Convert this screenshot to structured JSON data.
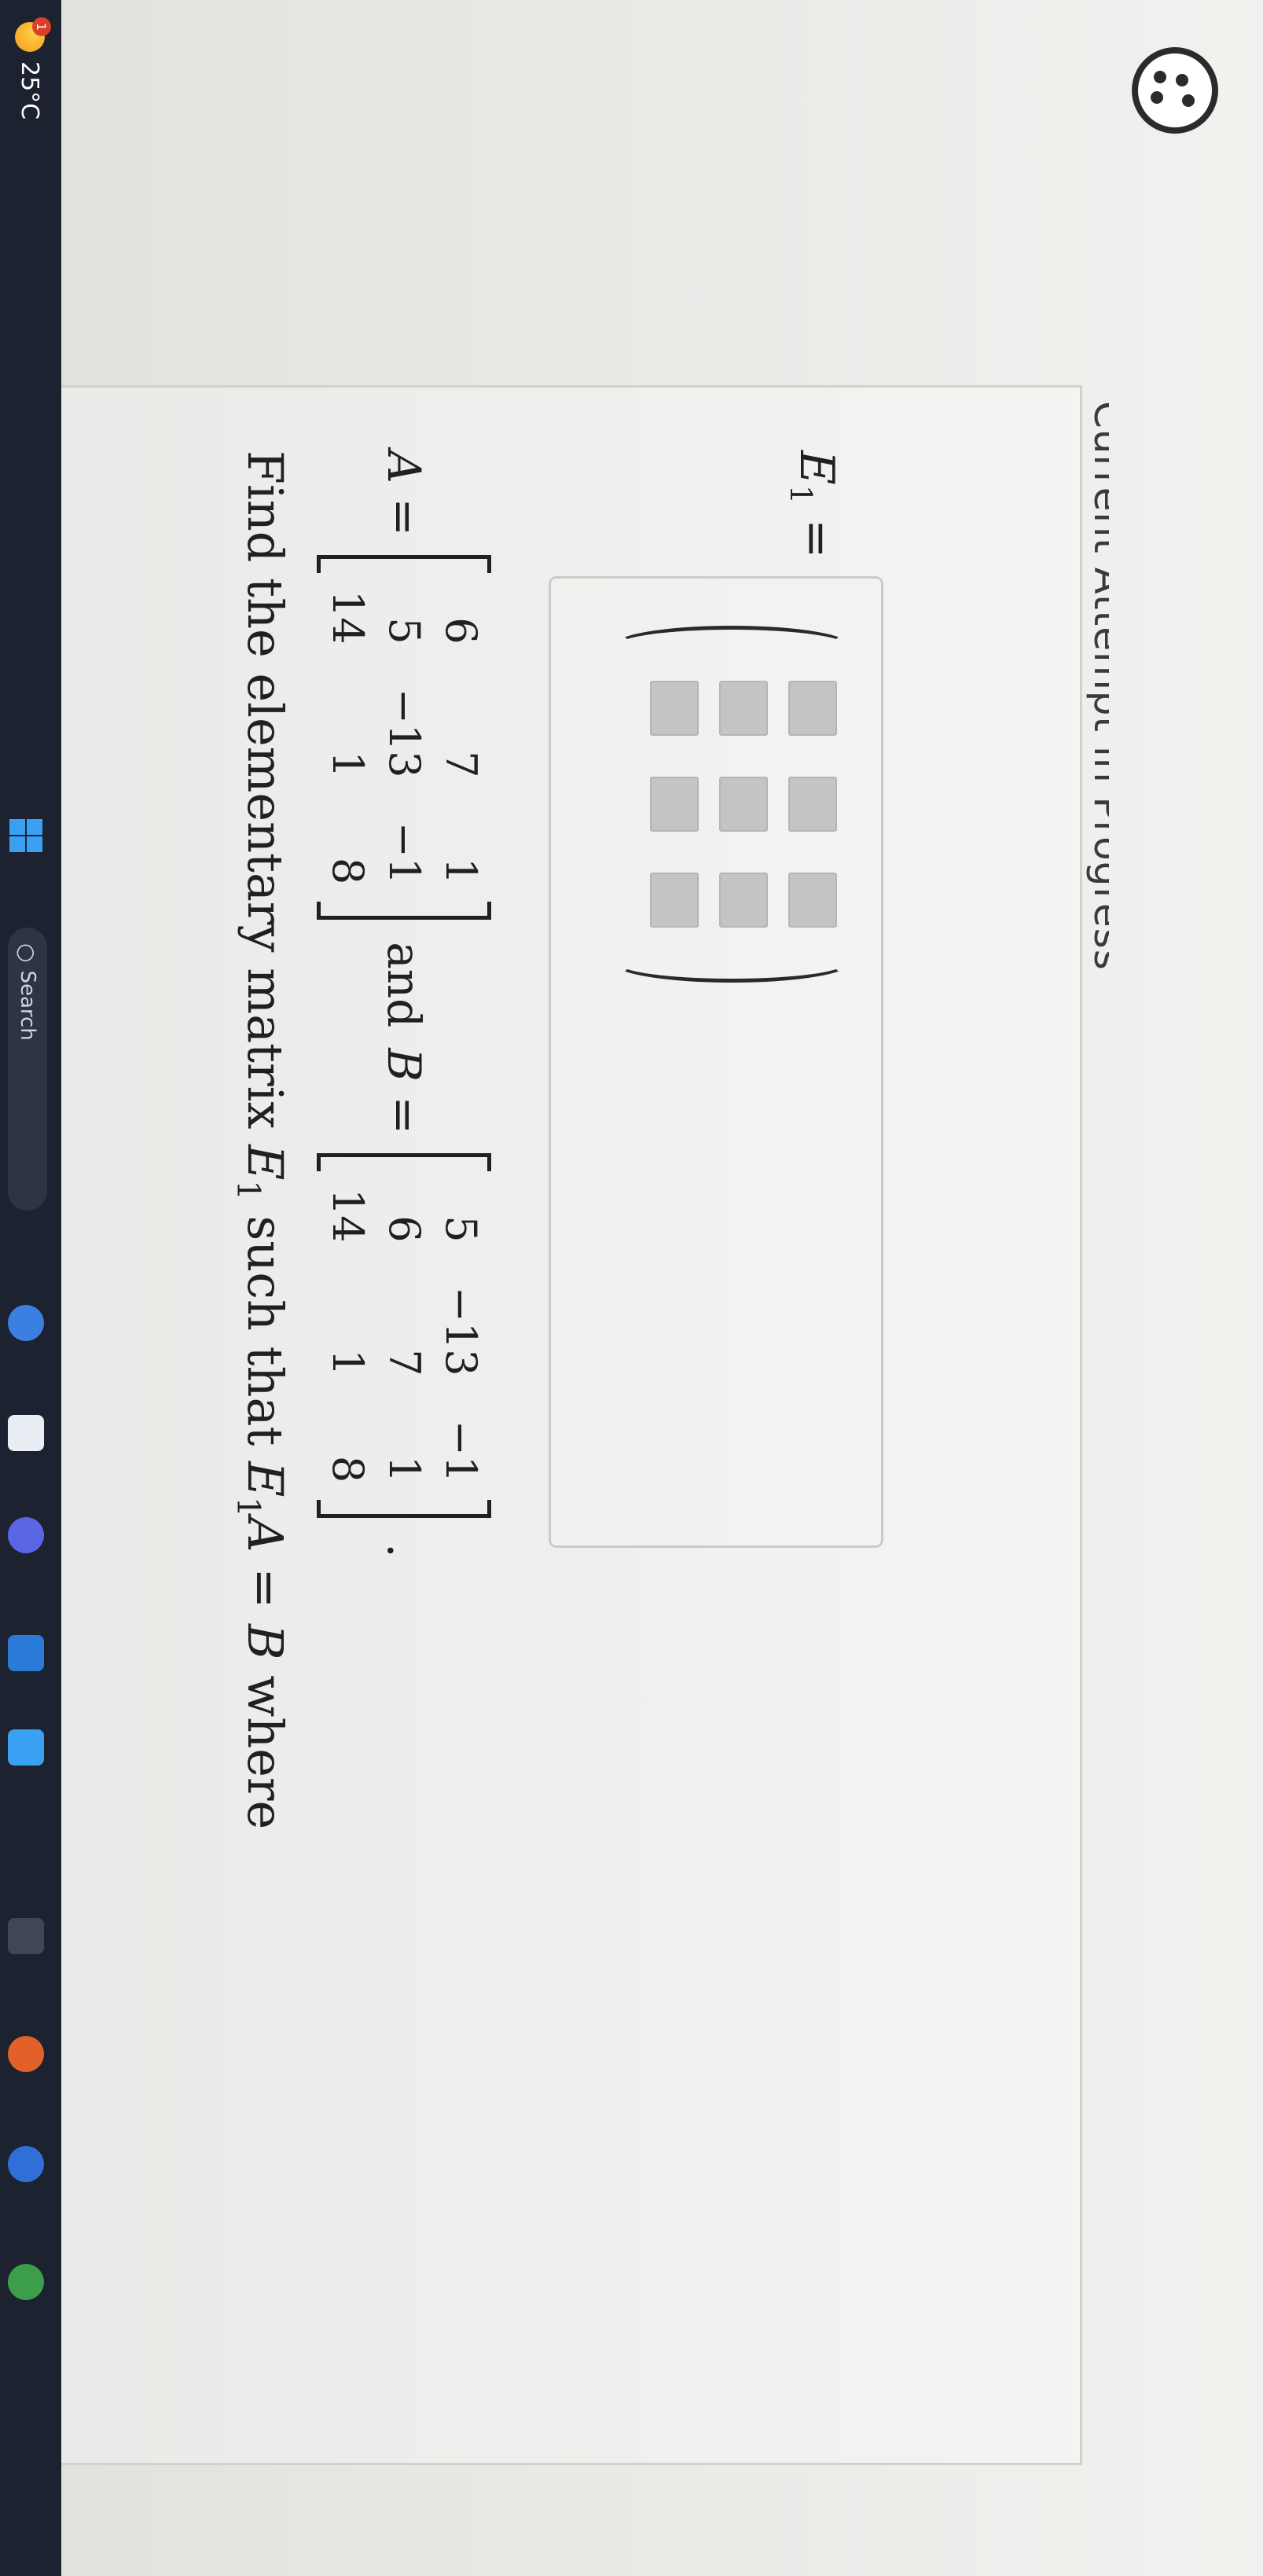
{
  "header": {
    "attempt_status": "Current Attempt in Progress"
  },
  "taskbar": {
    "weather_temp": "25°C",
    "weather_badge": "1",
    "search_label": "Search"
  },
  "question": {
    "prompt_before": "Find the elementary matrix ",
    "E_symbol": "E",
    "E_sub": "1",
    "prompt_middle": " such that ",
    "eq_left_E": "E",
    "eq_left_sub": "1",
    "eq_left_rest": "A = ",
    "eq_right": "B",
    "prompt_after": " where",
    "A_label": "A =",
    "and_word": "and",
    "B_label": "B =",
    "period": ".",
    "matrix_A": [
      [
        "6",
        "7",
        "1"
      ],
      [
        "5",
        "−13",
        "−1"
      ],
      [
        "14",
        "1",
        "8"
      ]
    ],
    "matrix_B": [
      [
        "5",
        "−13",
        "−1"
      ],
      [
        "6",
        "7",
        "1"
      ],
      [
        "14",
        "1",
        "8"
      ]
    ]
  },
  "answer": {
    "label_E": "E",
    "label_sub": "1",
    "label_eq": " =",
    "cells": [
      [
        "",
        "",
        ""
      ],
      [
        "",
        "",
        ""
      ],
      [
        "",
        "",
        ""
      ]
    ]
  }
}
